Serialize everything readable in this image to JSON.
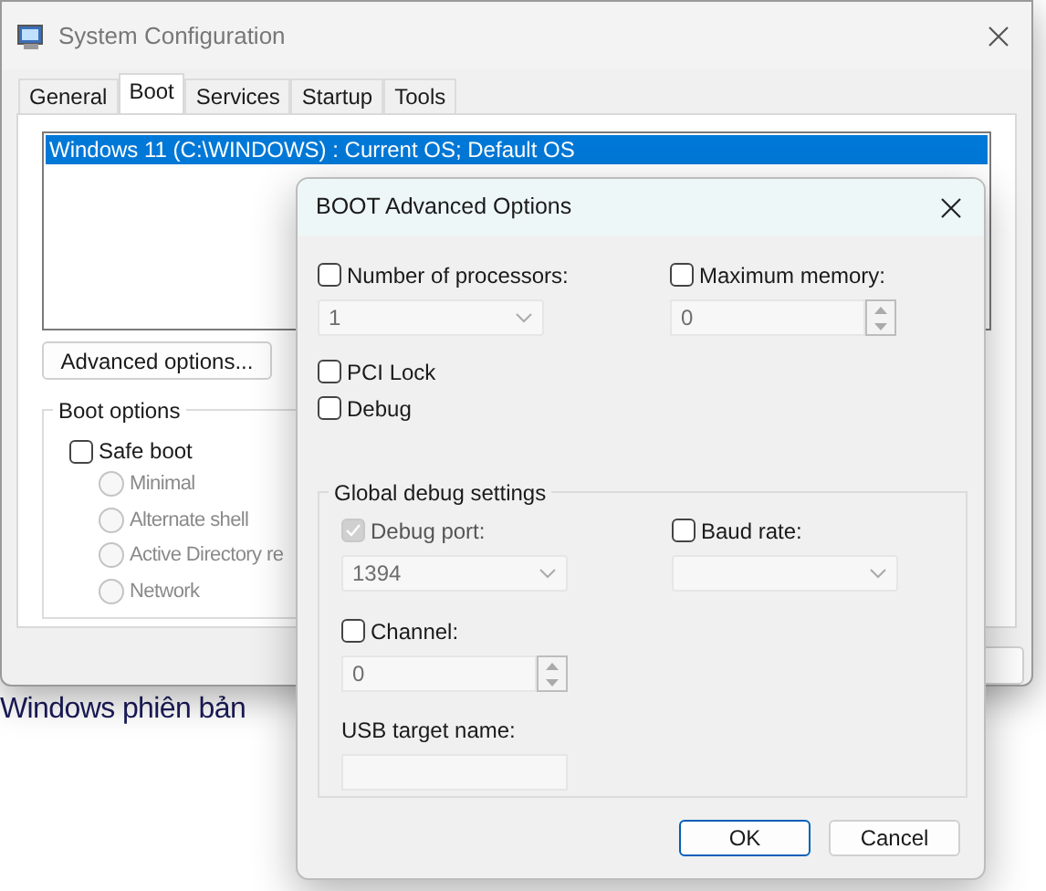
{
  "background_text": "Windows phiên bản",
  "window": {
    "title": "System Configuration",
    "tabs": [
      {
        "label": "General",
        "selected": false
      },
      {
        "label": "Boot",
        "selected": true
      },
      {
        "label": "Services",
        "selected": false
      },
      {
        "label": "Startup",
        "selected": false
      },
      {
        "label": "Tools",
        "selected": false
      }
    ],
    "boot_list": [
      {
        "text": "Windows 11 (C:\\WINDOWS) : Current OS; Default OS",
        "selected": true
      }
    ],
    "advanced_button": "Advanced options...",
    "boot_options": {
      "title": "Boot options",
      "safe_boot": {
        "label": "Safe boot",
        "checked": false
      },
      "modes": [
        {
          "label": "Minimal",
          "selected": false,
          "disabled": true
        },
        {
          "label": "Alternate shell",
          "selected": false,
          "disabled": true
        },
        {
          "label": "Active Directory re",
          "selected": false,
          "disabled": true
        },
        {
          "label": "Network",
          "selected": false,
          "disabled": true
        }
      ]
    }
  },
  "dialog": {
    "title": "BOOT Advanced Options",
    "number_of_processors": {
      "label": "Number of processors:",
      "checked": false,
      "value": "1"
    },
    "maximum_memory": {
      "label": "Maximum memory:",
      "checked": false,
      "value": "0"
    },
    "pci_lock": {
      "label": "PCI Lock",
      "checked": false
    },
    "debug": {
      "label": "Debug",
      "checked": false
    },
    "global_debug": {
      "title": "Global debug settings",
      "debug_port": {
        "label": "Debug port:",
        "checked": true,
        "value": "1394"
      },
      "baud_rate": {
        "label": "Baud rate:",
        "checked": false
      },
      "channel": {
        "label": "Channel:",
        "checked": false,
        "value": "0"
      },
      "usb_target_name": {
        "label": "USB target name:"
      }
    },
    "buttons": [
      {
        "label": "OK",
        "default": true
      },
      {
        "label": "Cancel",
        "default": false
      }
    ]
  }
}
